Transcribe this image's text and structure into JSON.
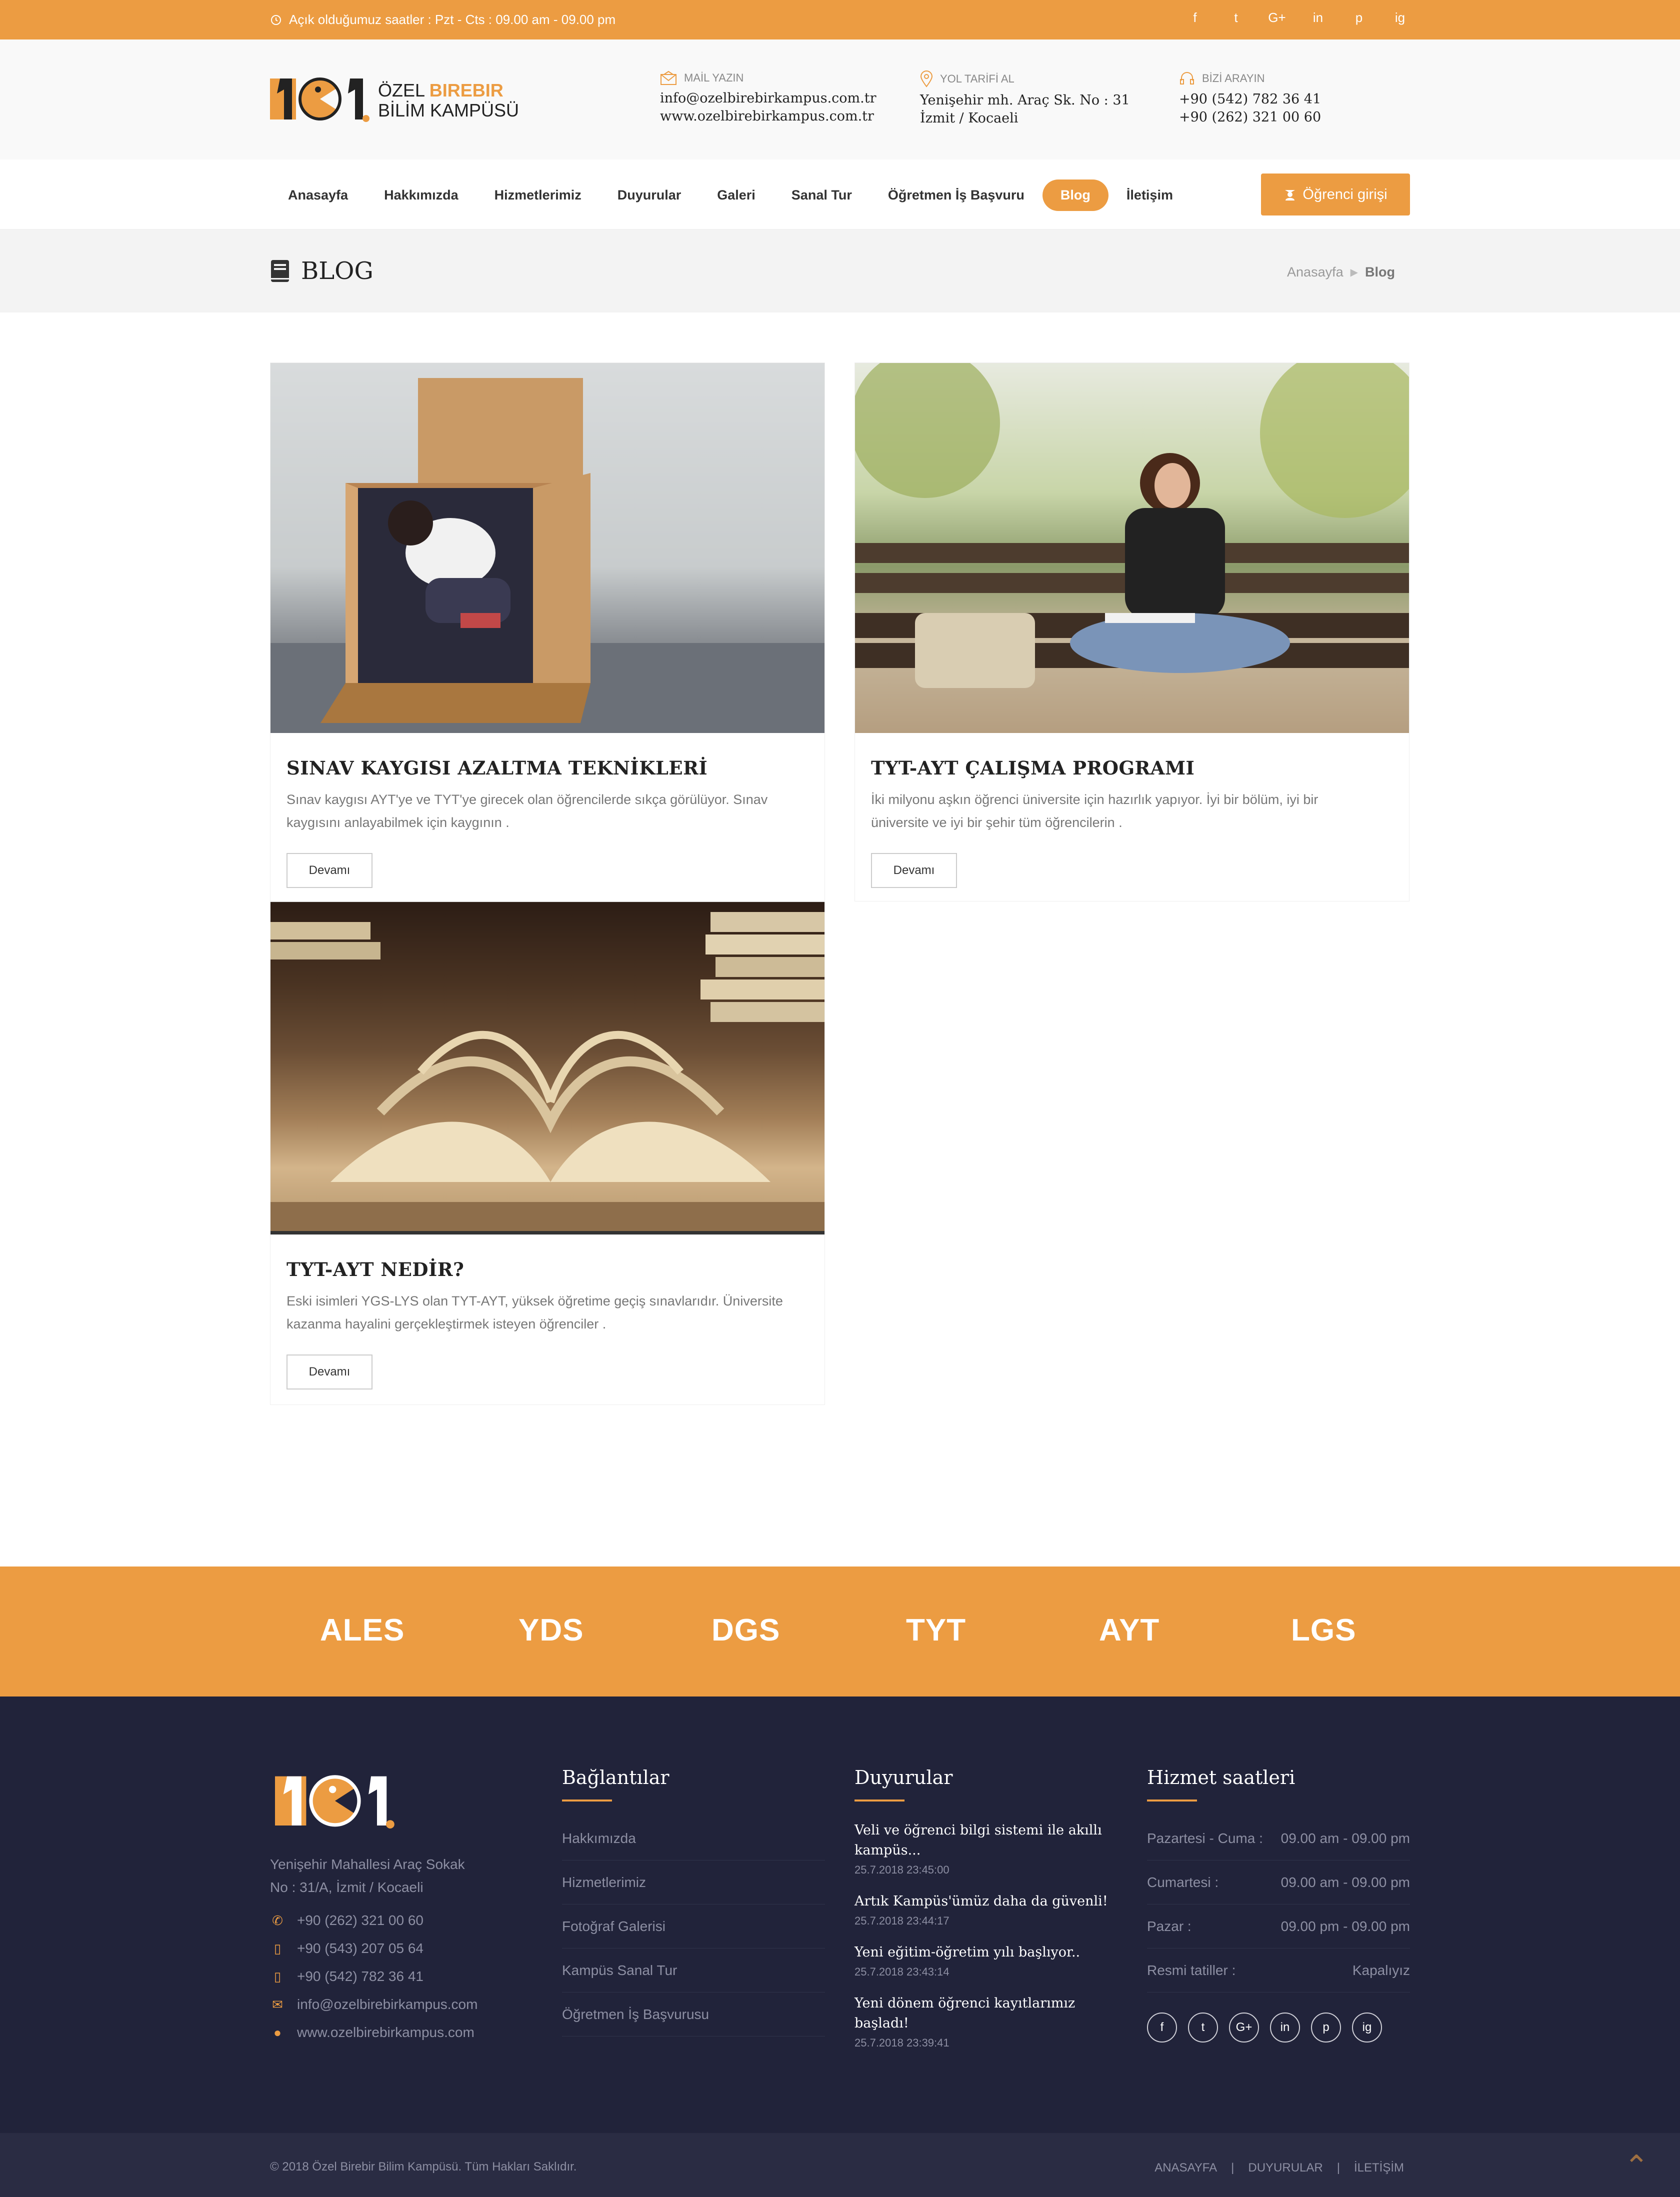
{
  "topbar": {
    "hours": "Açık olduğumuz saatler : Pzt - Cts : 09.00 am - 09.00 pm",
    "socials": [
      "f",
      "t",
      "G+",
      "in",
      "p",
      "ig"
    ]
  },
  "logo": {
    "line1_a": "ÖZEL ",
    "line1_b": "BIREBIR",
    "line2": "BİLİM KAMPÜSÜ",
    "mark": "1C1"
  },
  "contacts": [
    {
      "label": "MAİL YAZIN",
      "l1": "info@ozelbirebirkampus.com.tr",
      "l2": "www.ozelbirebirkampus.com.tr"
    },
    {
      "label": "YOL TARİFİ AL",
      "l1": "Yenişehir mh. Araç Sk. No : 31",
      "l2": "İzmit / Kocaeli"
    },
    {
      "label": "BİZİ ARAYIN",
      "l1": "+90 (542) 782 36 41",
      "l2": "+90 (262) 321 00 60"
    }
  ],
  "nav": {
    "items": [
      "Anasayfa",
      "Hakkımızda",
      "Hizmetlerimiz",
      "Duyurular",
      "Galeri",
      "Sanal Tur",
      "Öğretmen İş Başvuru",
      "Blog",
      "İletişim"
    ],
    "login": "Öğrenci girişi"
  },
  "page": {
    "title": "BLOG",
    "crumb_home": "Anasayfa",
    "crumb_sep": "▶",
    "crumb_current": "Blog"
  },
  "posts": [
    {
      "title": "SINAV KAYGISI AZALTMA TEKNİKLERİ",
      "excerpt": "Sınav kaygısı  AYT'ye ve TYT'ye girecek olan öğrencilerde sıkça görülüyor. Sınav kaygısını anlayabilmek için kaygının .",
      "more": "Devamı"
    },
    {
      "title": "TYT-AYT ÇALIŞMA PROGRAMI",
      "excerpt": "İki milyonu aşkın öğrenci  üniversite için hazırlık yapıyor. İyi bir bölüm, iyi bir üniversite ve iyi bir şehir tüm öğrencilerin .",
      "more": "Devamı"
    },
    {
      "title": "TYT-AYT NEDİR?",
      "excerpt": "Eski isimleri YGS-LYS olan TYT-AYT, yüksek öğretime geçiş sınavlarıdır. Üniversite kazanma hayalini gerçekleştirmek isteyen öğrenciler .",
      "more": "Devamı"
    }
  ],
  "exams": [
    "ALES",
    "YDS",
    "DGS",
    "TYT",
    "AYT",
    "LGS"
  ],
  "footer": {
    "address1": "Yenişehir Mahallesi Araç Sokak",
    "address2": "No : 31/A, İzmit / Kocaeli",
    "contacts": [
      {
        "icon": "phone-icon",
        "text": "+90 (262) 321 00 60"
      },
      {
        "icon": "mobile-icon",
        "text": "+90 (543) 207 05 64"
      },
      {
        "icon": "mobile-icon",
        "text": "+90 (542) 782 36 41"
      },
      {
        "icon": "mail-icon",
        "text": "info@ozelbirebirkampus.com"
      },
      {
        "icon": "globe-icon",
        "text": "www.ozelbirebirkampus.com"
      }
    ],
    "links_title": "Bağlantılar",
    "links": [
      "Hakkımızda",
      "Hizmetlerimiz",
      "Fotoğraf Galerisi",
      "Kampüs Sanal Tur",
      "Öğretmen İş Başvurusu"
    ],
    "news_title": "Duyurular",
    "news": [
      {
        "t": "Veli ve öğrenci bilgi sistemi ile akıllı kampüs...",
        "d": "25.7.2018 23:45:00"
      },
      {
        "t": "Artık Kampüs'ümüz daha da güvenli!",
        "d": "25.7.2018 23:44:17"
      },
      {
        "t": "Yeni eğitim-öğretim yılı başlıyor..",
        "d": "25.7.2018 23:43:14"
      },
      {
        "t": "Yeni dönem öğrenci kayıtlarımız başladı!",
        "d": "25.7.2018 23:39:41"
      }
    ],
    "hours_title": "Hizmet saatleri",
    "hours": [
      {
        "day": "Pazartesi - Cuma :",
        "time": "09.00 am - 09.00 pm"
      },
      {
        "day": "Cumartesi :",
        "time": "09.00 am - 09.00 pm"
      },
      {
        "day": "Pazar :",
        "time": "09.00 pm - 09.00 pm"
      },
      {
        "day": "Resmi tatiller :",
        "time": "Kapalıyız"
      }
    ],
    "socials": [
      "f",
      "t",
      "G+",
      "in",
      "p",
      "ig"
    ],
    "copyright": "© 2018 Özel Birebir Bilim Kampüsü. Tüm Hakları Saklıdır.",
    "bottom_links": [
      "ANASAYFA",
      "|",
      "DUYURULAR",
      "|",
      "İLETİŞİM"
    ]
  },
  "colors": {
    "accent": "#ec9c42",
    "footer": "#21233a"
  }
}
